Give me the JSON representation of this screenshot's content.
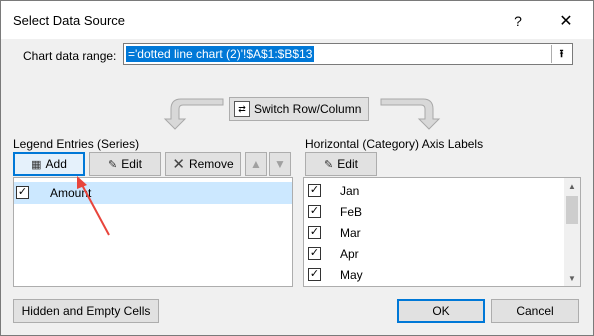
{
  "dialog": {
    "title": "Select Data Source",
    "help_label": "?",
    "close_label": "✕"
  },
  "range": {
    "label": "Chart data range:",
    "value": "='dotted line chart (2)'!$A$1:$B$13",
    "collapse_glyph": "⭱"
  },
  "switch": {
    "label": "Switch Row/Column"
  },
  "legend": {
    "group_label": "Legend Entries (Series)",
    "add_label": "Add",
    "edit_label": "Edit",
    "remove_label": "Remove",
    "up_glyph": "▲",
    "down_glyph": "▼",
    "series": [
      {
        "name": "Amount",
        "checked": "☑"
      }
    ]
  },
  "axis": {
    "group_label": "Horizontal (Category) Axis Labels",
    "edit_label": "Edit",
    "items": [
      {
        "label": "Jan",
        "check": "✓"
      },
      {
        "label": "FeB",
        "check": "✓"
      },
      {
        "label": "Mar",
        "check": "✓"
      },
      {
        "label": "Apr",
        "check": "✓"
      },
      {
        "label": "May",
        "check": "✓"
      }
    ],
    "scroll_up": "▲",
    "scroll_down": "▼"
  },
  "footer": {
    "hidden_label": "Hidden and Empty Cells",
    "ok_label": "OK",
    "cancel_label": "Cancel"
  },
  "colors": {
    "accent": "#0078d7",
    "selection": "#cce8ff",
    "annotation_arrow": "#e8453c"
  }
}
